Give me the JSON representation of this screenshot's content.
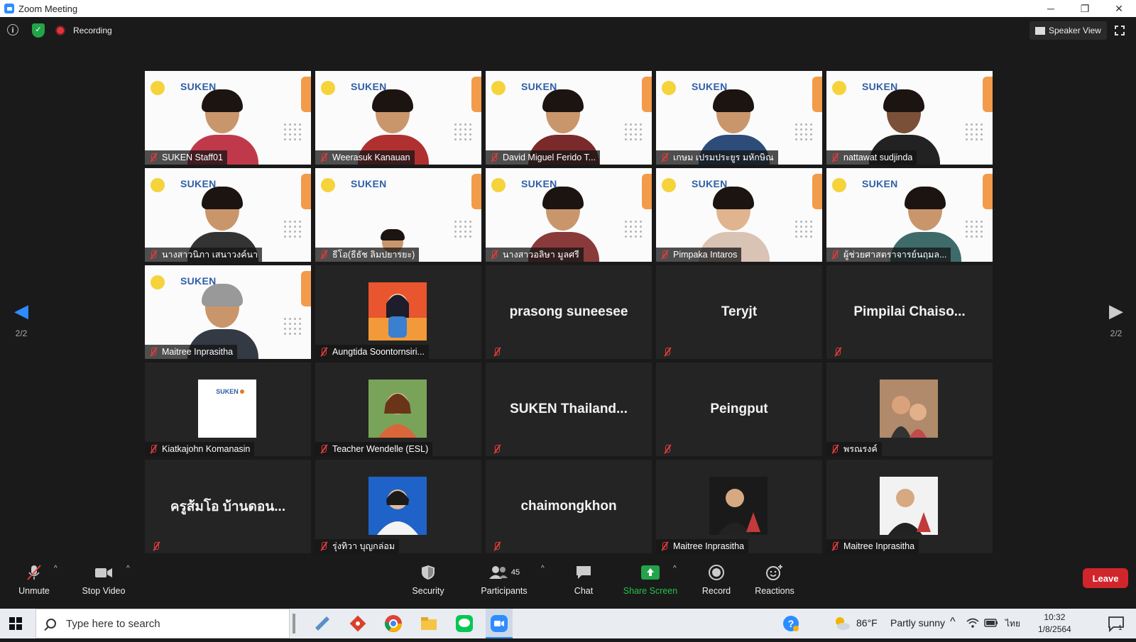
{
  "window": {
    "title": "Zoom Meeting",
    "minimize": "─",
    "restore": "❐",
    "close": "✕"
  },
  "meeting_bar": {
    "info_icon": "i",
    "shield_icon": "✓",
    "recording_label": "Recording",
    "speaker_view_label": "Speaker View"
  },
  "pagination": {
    "prev_page": "2/2",
    "next_page": "2/2"
  },
  "participants": [
    {
      "name": "SUKEN Staff01",
      "type": "video",
      "muted": true
    },
    {
      "name": "Weerasuk Kanauan",
      "type": "video",
      "muted": true
    },
    {
      "name": "David Miguel Ferido T...",
      "type": "video",
      "muted": true
    },
    {
      "name": "เกษม เปรมประยูร มหักษิณ",
      "type": "video",
      "muted": true
    },
    {
      "name": "nattawat sudjinda",
      "type": "video",
      "muted": true
    },
    {
      "name": "นางสาวนิภา เสนาวงค์นา",
      "type": "video",
      "muted": true
    },
    {
      "name": "ธีโอ(ธีธัช ลิมปยารยะ)",
      "type": "video",
      "muted": true
    },
    {
      "name": "นางสาวอลิษา มูลศรี",
      "type": "video",
      "muted": true
    },
    {
      "name": "Pimpaka Intaros",
      "type": "video",
      "muted": true
    },
    {
      "name": "ผู้ช่วยศาสตราจารย์นฤมล...",
      "type": "video",
      "muted": true
    },
    {
      "name": "Maitree Inprasitha",
      "type": "video",
      "muted": true
    },
    {
      "name": "Aungtida Soontornsiri...",
      "type": "avatar",
      "muted": true
    },
    {
      "name": "prasong suneesee",
      "type": "text",
      "muted": true
    },
    {
      "name": "Teryjt",
      "type": "text",
      "muted": true
    },
    {
      "name": "Pimpilai  Chaiso...",
      "type": "text",
      "muted": true
    },
    {
      "name": "Kiatkajohn Komanasin",
      "type": "avatar",
      "muted": true
    },
    {
      "name": "Teacher Wendelle (ESL)",
      "type": "avatar",
      "muted": true
    },
    {
      "name": "SUKEN  Thailand...",
      "type": "text",
      "muted": true
    },
    {
      "name": "Peingput",
      "type": "text",
      "muted": true
    },
    {
      "name": "พรณรงค์",
      "type": "avatar",
      "muted": true
    },
    {
      "name": "ครูส้มโอ บ้านดอน...",
      "type": "text",
      "muted": true
    },
    {
      "name": "รุ่งทิวา บุญกล่อม",
      "type": "avatar",
      "muted": true
    },
    {
      "name": "chaimongkhon",
      "type": "text",
      "muted": true
    },
    {
      "name": "Maitree Inprasitha",
      "type": "avatar",
      "muted": true
    },
    {
      "name": "Maitree Inprasitha",
      "type": "avatar",
      "muted": true
    }
  ],
  "slide_logo": "SUKEN",
  "toolbar": {
    "unmute": "Unmute",
    "stop_video": "Stop Video",
    "security": "Security",
    "participants": "Participants",
    "participants_count": "45",
    "chat": "Chat",
    "share_screen": "Share Screen",
    "record": "Record",
    "reactions": "Reactions",
    "leave": "Leave"
  },
  "taskbar": {
    "search_placeholder": "Type here to search",
    "weather_temp": "86°F",
    "weather_desc": "Partly sunny",
    "language": "ไทย",
    "time": "10:32",
    "date": "1/8/2564",
    "notification_count": "1"
  },
  "colors": {
    "accent": "#2d8cff",
    "leave": "#d1252c",
    "share": "#23a34a",
    "mute": "#e03b3b"
  }
}
